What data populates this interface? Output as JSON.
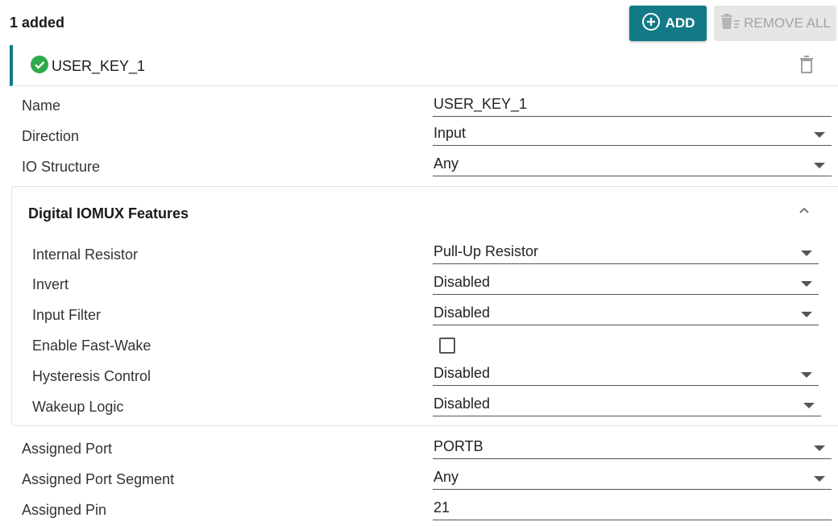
{
  "header": {
    "count_text": "1 added",
    "add_label": "ADD",
    "remove_all_label": "REMOVE ALL"
  },
  "item": {
    "title": "USER_KEY_1"
  },
  "fields": {
    "name": {
      "label": "Name",
      "value": "USER_KEY_1"
    },
    "direction": {
      "label": "Direction",
      "value": "Input"
    },
    "io_structure": {
      "label": "IO Structure",
      "value": "Any"
    },
    "assigned_port": {
      "label": "Assigned Port",
      "value": "PORTB"
    },
    "assigned_port_segment": {
      "label": "Assigned Port Segment",
      "value": "Any"
    },
    "assigned_pin": {
      "label": "Assigned Pin",
      "value": "21"
    }
  },
  "panel": {
    "title": "Digital IOMUX Features",
    "internal_resistor": {
      "label": "Internal Resistor",
      "value": "Pull-Up Resistor"
    },
    "invert": {
      "label": "Invert",
      "value": "Disabled"
    },
    "input_filter": {
      "label": "Input Filter",
      "value": "Disabled"
    },
    "enable_fast_wake": {
      "label": "Enable Fast-Wake",
      "checked": false
    },
    "hysteresis_control": {
      "label": "Hysteresis Control",
      "value": "Disabled"
    },
    "wakeup_logic": {
      "label": "Wakeup Logic",
      "value": "Disabled"
    }
  },
  "colors": {
    "accent": "#127a86",
    "success": "#2eaa4a",
    "disabled_bg": "#e6e6e6",
    "disabled_text": "#a3a3a3"
  },
  "icons": {
    "add": "add-circle-icon",
    "remove_all": "delete-sweep-icon",
    "status": "check-circle-icon",
    "delete": "trash-icon",
    "collapse": "chevron-up-icon"
  }
}
